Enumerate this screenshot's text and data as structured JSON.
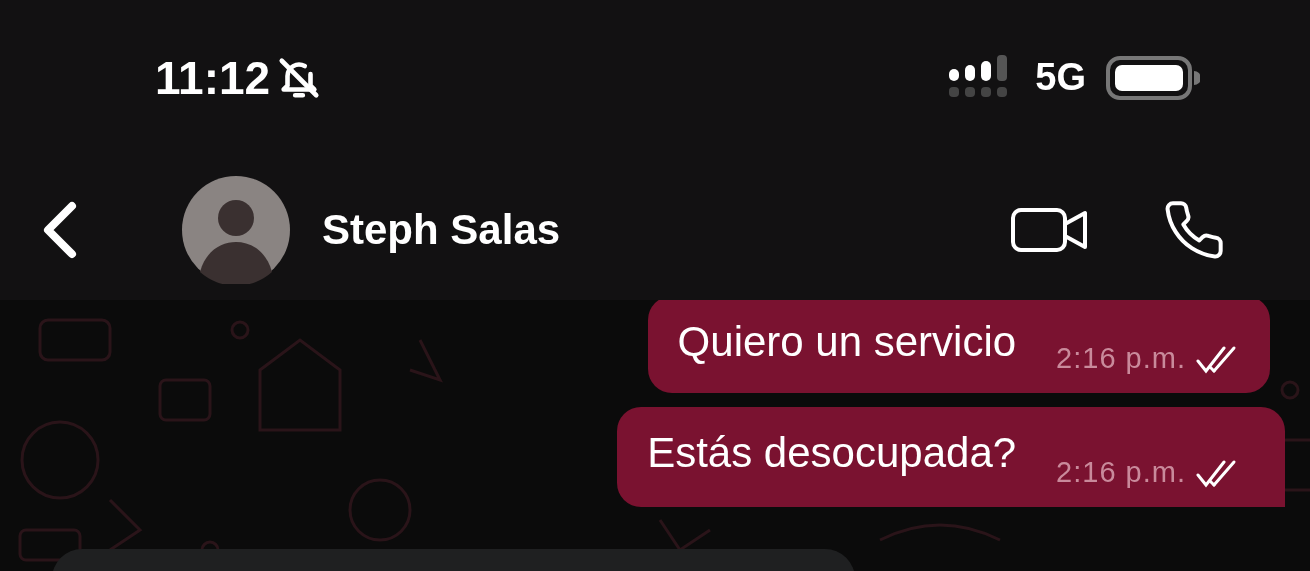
{
  "status_bar": {
    "time": "11:12",
    "silenced": true,
    "network": "5G"
  },
  "header": {
    "contact_name": "Steph Salas"
  },
  "messages": [
    {
      "text": "Quiero un servicio",
      "time": "2:16 p.m.",
      "tail": false
    },
    {
      "text": "Estás desocupada?",
      "time": "2:16 p.m.",
      "tail": true
    }
  ]
}
